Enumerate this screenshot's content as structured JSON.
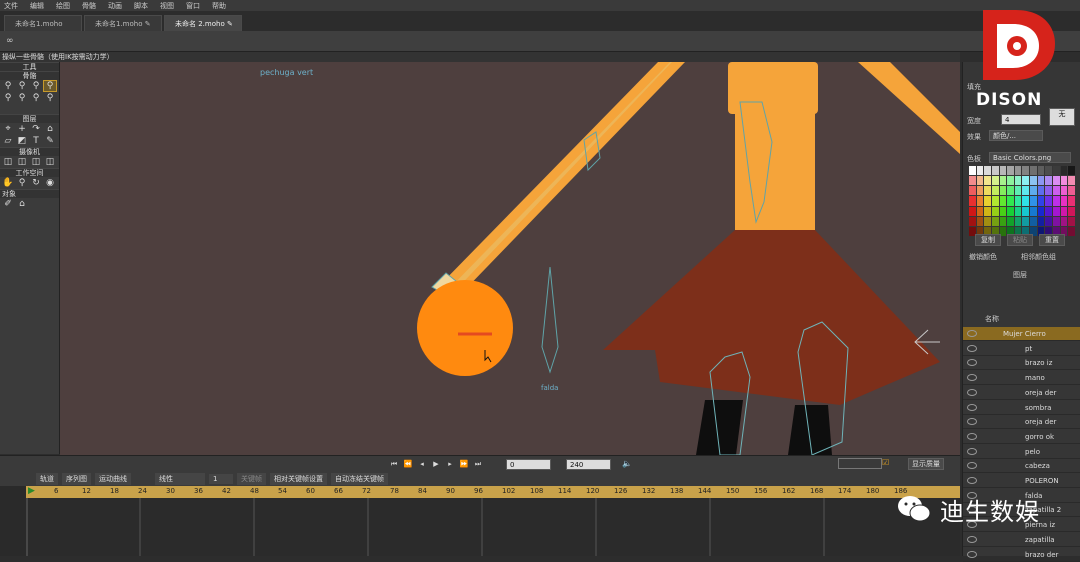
{
  "menu": [
    "文件",
    "编辑",
    "绘图",
    "骨骼",
    "动画",
    "脚本",
    "视图",
    "窗口",
    "帮助"
  ],
  "tabs": [
    {
      "label": "未命名1.moho"
    },
    {
      "label": "未命名1.moho ✎"
    },
    {
      "label": "未命名 2.moho ✎"
    }
  ],
  "status_text": "操纵一些骨骼（使用IK按需动力学）",
  "toolbox": {
    "section1": "工具",
    "section2": "骨骼",
    "section3": "图层",
    "section4": "摄像机",
    "section5": "工作空间",
    "section6": "对象"
  },
  "canvas": {
    "bone_label_top": "pechuga vert",
    "bone_label_falda": "falda"
  },
  "playbar": {
    "frame_value": "0",
    "end_value": "240",
    "display_quality": "显示质量"
  },
  "timeline": {
    "tabs": [
      "轨道",
      "序列图",
      "运动曲线"
    ],
    "mode": "线性",
    "count": "1",
    "option1": "关键帧",
    "option2": "相对关键帧设置",
    "option3": "自动冻结关键帧",
    "ruler": [
      "0",
      "6",
      "12",
      "18",
      "24",
      "30",
      "36",
      "42",
      "48",
      "54",
      "60",
      "66",
      "72",
      "78",
      "84",
      "90",
      "96",
      "102",
      "108",
      "114",
      "120",
      "126",
      "132",
      "138",
      "144",
      "150",
      "156",
      "162",
      "168",
      "174",
      "180",
      "186"
    ]
  },
  "rightpanel": {
    "fill_label": "填充",
    "width_label": "宽度",
    "width_value": "4",
    "none_label": "无",
    "effect_label": "效果",
    "effect_value": "颜色/...",
    "palette_label": "色板",
    "palette_value": "Basic Colors.png",
    "btn_copy": "复制",
    "btn_paste": "粘贴",
    "btn_reset": "重置",
    "chk1": "撤销颜色",
    "chk2": "相邻颜色组",
    "layers_title": "图层",
    "layers_header": "名称",
    "layers": [
      {
        "name": "Mujer Cierro",
        "active": true
      },
      {
        "name": "pt"
      },
      {
        "name": "brazo iz"
      },
      {
        "name": "mano"
      },
      {
        "name": "oreja der"
      },
      {
        "name": "sombra"
      },
      {
        "name": "oreja der"
      },
      {
        "name": "gorro ok"
      },
      {
        "name": "pelo"
      },
      {
        "name": "cabeza"
      },
      {
        "name": "POLERON"
      },
      {
        "name": "falda"
      },
      {
        "name": "zapatilla 2"
      },
      {
        "name": "pierna iz"
      },
      {
        "name": "zapatilla"
      },
      {
        "name": "brazo der"
      }
    ]
  },
  "watermark": {
    "logo_text": "DISON",
    "caption": "迪生数娱"
  }
}
